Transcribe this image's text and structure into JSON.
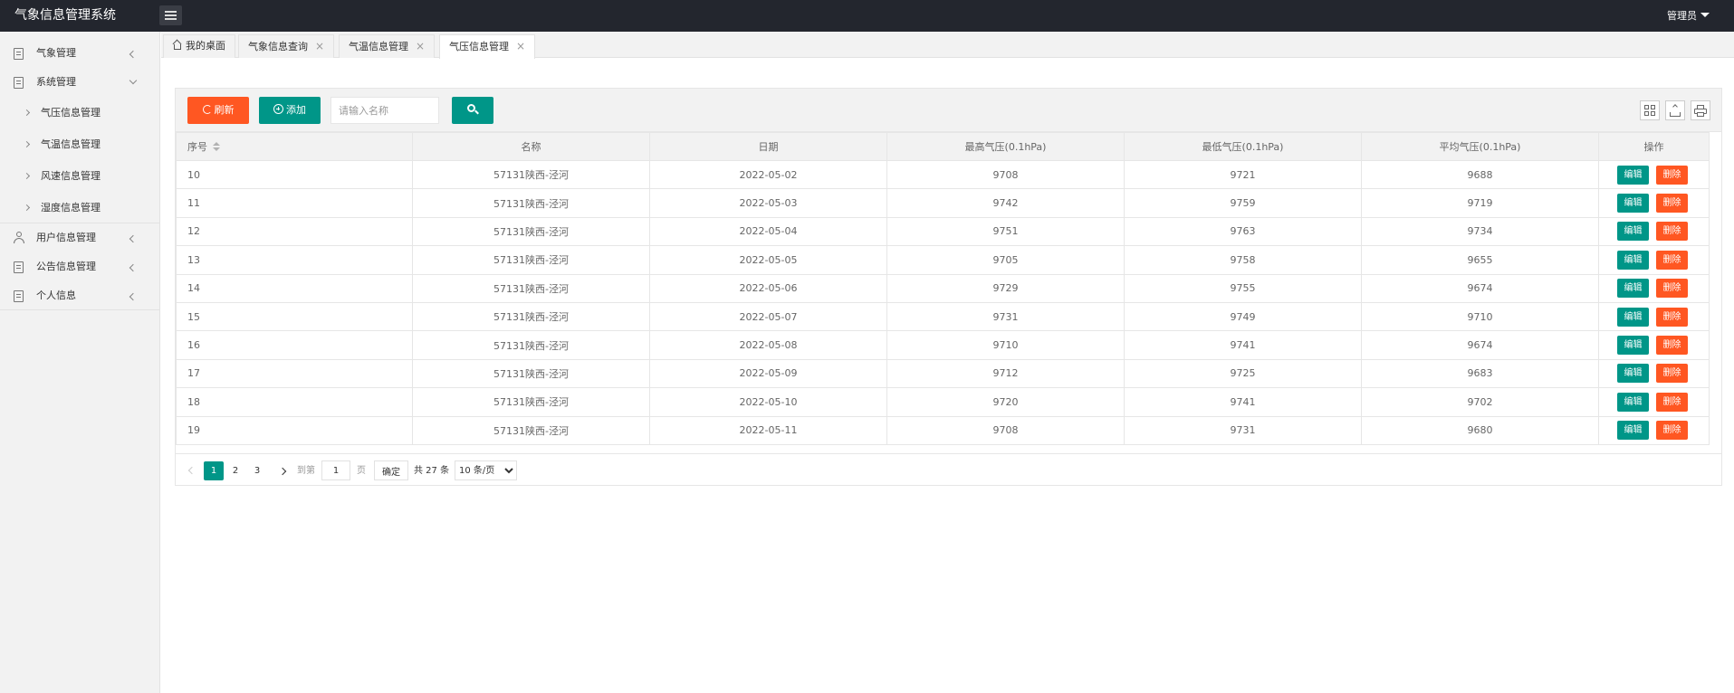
{
  "app": {
    "title": "气象信息管理系统",
    "user": "管理员"
  },
  "sidebar": {
    "items": [
      {
        "label": "气象管理"
      },
      {
        "label": "系统管理"
      },
      {
        "label": "用户信息管理"
      },
      {
        "label": "公告信息管理"
      },
      {
        "label": "个人信息"
      }
    ],
    "subitems": [
      {
        "label": "气压信息管理"
      },
      {
        "label": "气温信息管理"
      },
      {
        "label": "风速信息管理"
      },
      {
        "label": "湿度信息管理"
      }
    ]
  },
  "tabs": [
    {
      "label": "我的桌面"
    },
    {
      "label": "气象信息查询"
    },
    {
      "label": "气温信息管理"
    },
    {
      "label": "气压信息管理"
    }
  ],
  "toolbar": {
    "refresh_label": "刷新",
    "add_label": "添加",
    "search_placeholder": "请输入名称"
  },
  "table": {
    "headers": [
      "序号",
      "名称",
      "日期",
      "最高气压(0.1hPa)",
      "最低气压(0.1hPa)",
      "平均气压(0.1hPa)",
      "操作"
    ],
    "edit_label": "编辑",
    "delete_label": "删除",
    "rows": [
      {
        "id": "10",
        "name": "57131陕西-泾河",
        "date": "2022-05-02",
        "max": "9708",
        "min": "9721",
        "avg": "9688"
      },
      {
        "id": "11",
        "name": "57131陕西-泾河",
        "date": "2022-05-03",
        "max": "9742",
        "min": "9759",
        "avg": "9719"
      },
      {
        "id": "12",
        "name": "57131陕西-泾河",
        "date": "2022-05-04",
        "max": "9751",
        "min": "9763",
        "avg": "9734"
      },
      {
        "id": "13",
        "name": "57131陕西-泾河",
        "date": "2022-05-05",
        "max": "9705",
        "min": "9758",
        "avg": "9655"
      },
      {
        "id": "14",
        "name": "57131陕西-泾河",
        "date": "2022-05-06",
        "max": "9729",
        "min": "9755",
        "avg": "9674"
      },
      {
        "id": "15",
        "name": "57131陕西-泾河",
        "date": "2022-05-07",
        "max": "9731",
        "min": "9749",
        "avg": "9710"
      },
      {
        "id": "16",
        "name": "57131陕西-泾河",
        "date": "2022-05-08",
        "max": "9710",
        "min": "9741",
        "avg": "9674"
      },
      {
        "id": "17",
        "name": "57131陕西-泾河",
        "date": "2022-05-09",
        "max": "9712",
        "min": "9725",
        "avg": "9683"
      },
      {
        "id": "18",
        "name": "57131陕西-泾河",
        "date": "2022-05-10",
        "max": "9720",
        "min": "9741",
        "avg": "9702"
      },
      {
        "id": "19",
        "name": "57131陕西-泾河",
        "date": "2022-05-11",
        "max": "9708",
        "min": "9731",
        "avg": "9680"
      }
    ]
  },
  "pagination": {
    "pages": [
      "1",
      "2",
      "3"
    ],
    "current": "1",
    "goto_label": "到第",
    "goto_value": "1",
    "page_unit": "页",
    "confirm_label": "确定",
    "total_text": "共 27 条",
    "page_size_label": "10 条/页"
  },
  "colors": {
    "primary": "#009688",
    "danger": "#ff5722",
    "header_bg": "#23262e"
  }
}
